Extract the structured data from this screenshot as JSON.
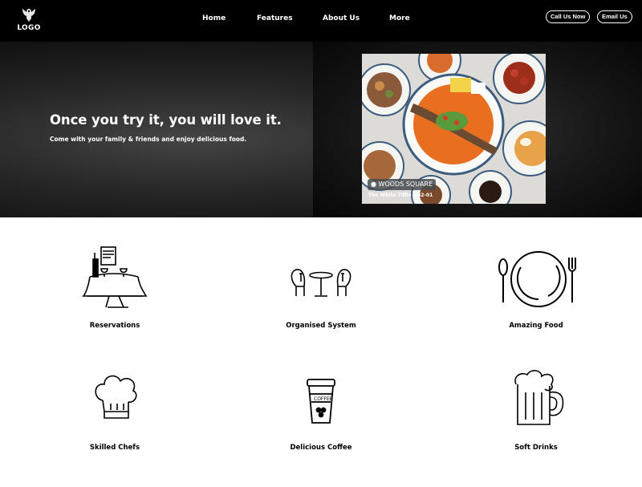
{
  "nav": {
    "logo_text": "LOGO",
    "links": [
      "Home",
      "Features",
      "About Us",
      "More"
    ],
    "call_button": "Call Us Now",
    "email_button": "Email Us"
  },
  "hero": {
    "title": "Once you try it, you will love it.",
    "subtitle": "Come with your family & friends and enjoy delicious food.",
    "photo": {
      "location_tag": "WOODS SQUARE",
      "location_sub": "The White Tiffin #B2-01"
    }
  },
  "features": [
    {
      "label": "Reservations",
      "icon": "dining-table-icon"
    },
    {
      "label": "Organised System",
      "icon": "bistro-set-icon"
    },
    {
      "label": "Amazing Food",
      "icon": "plate-cutlery-icon"
    },
    {
      "label": "Skilled Chefs",
      "icon": "chef-hat-icon"
    },
    {
      "label": "Delicious Coffee",
      "icon": "coffee-cup-icon"
    },
    {
      "label": "Soft Drinks",
      "icon": "beer-mug-icon"
    }
  ],
  "colors": {
    "nav_bg": "#000000",
    "hero_bg": "#262626",
    "text_light": "#ffffff",
    "text_dark": "#000000"
  }
}
